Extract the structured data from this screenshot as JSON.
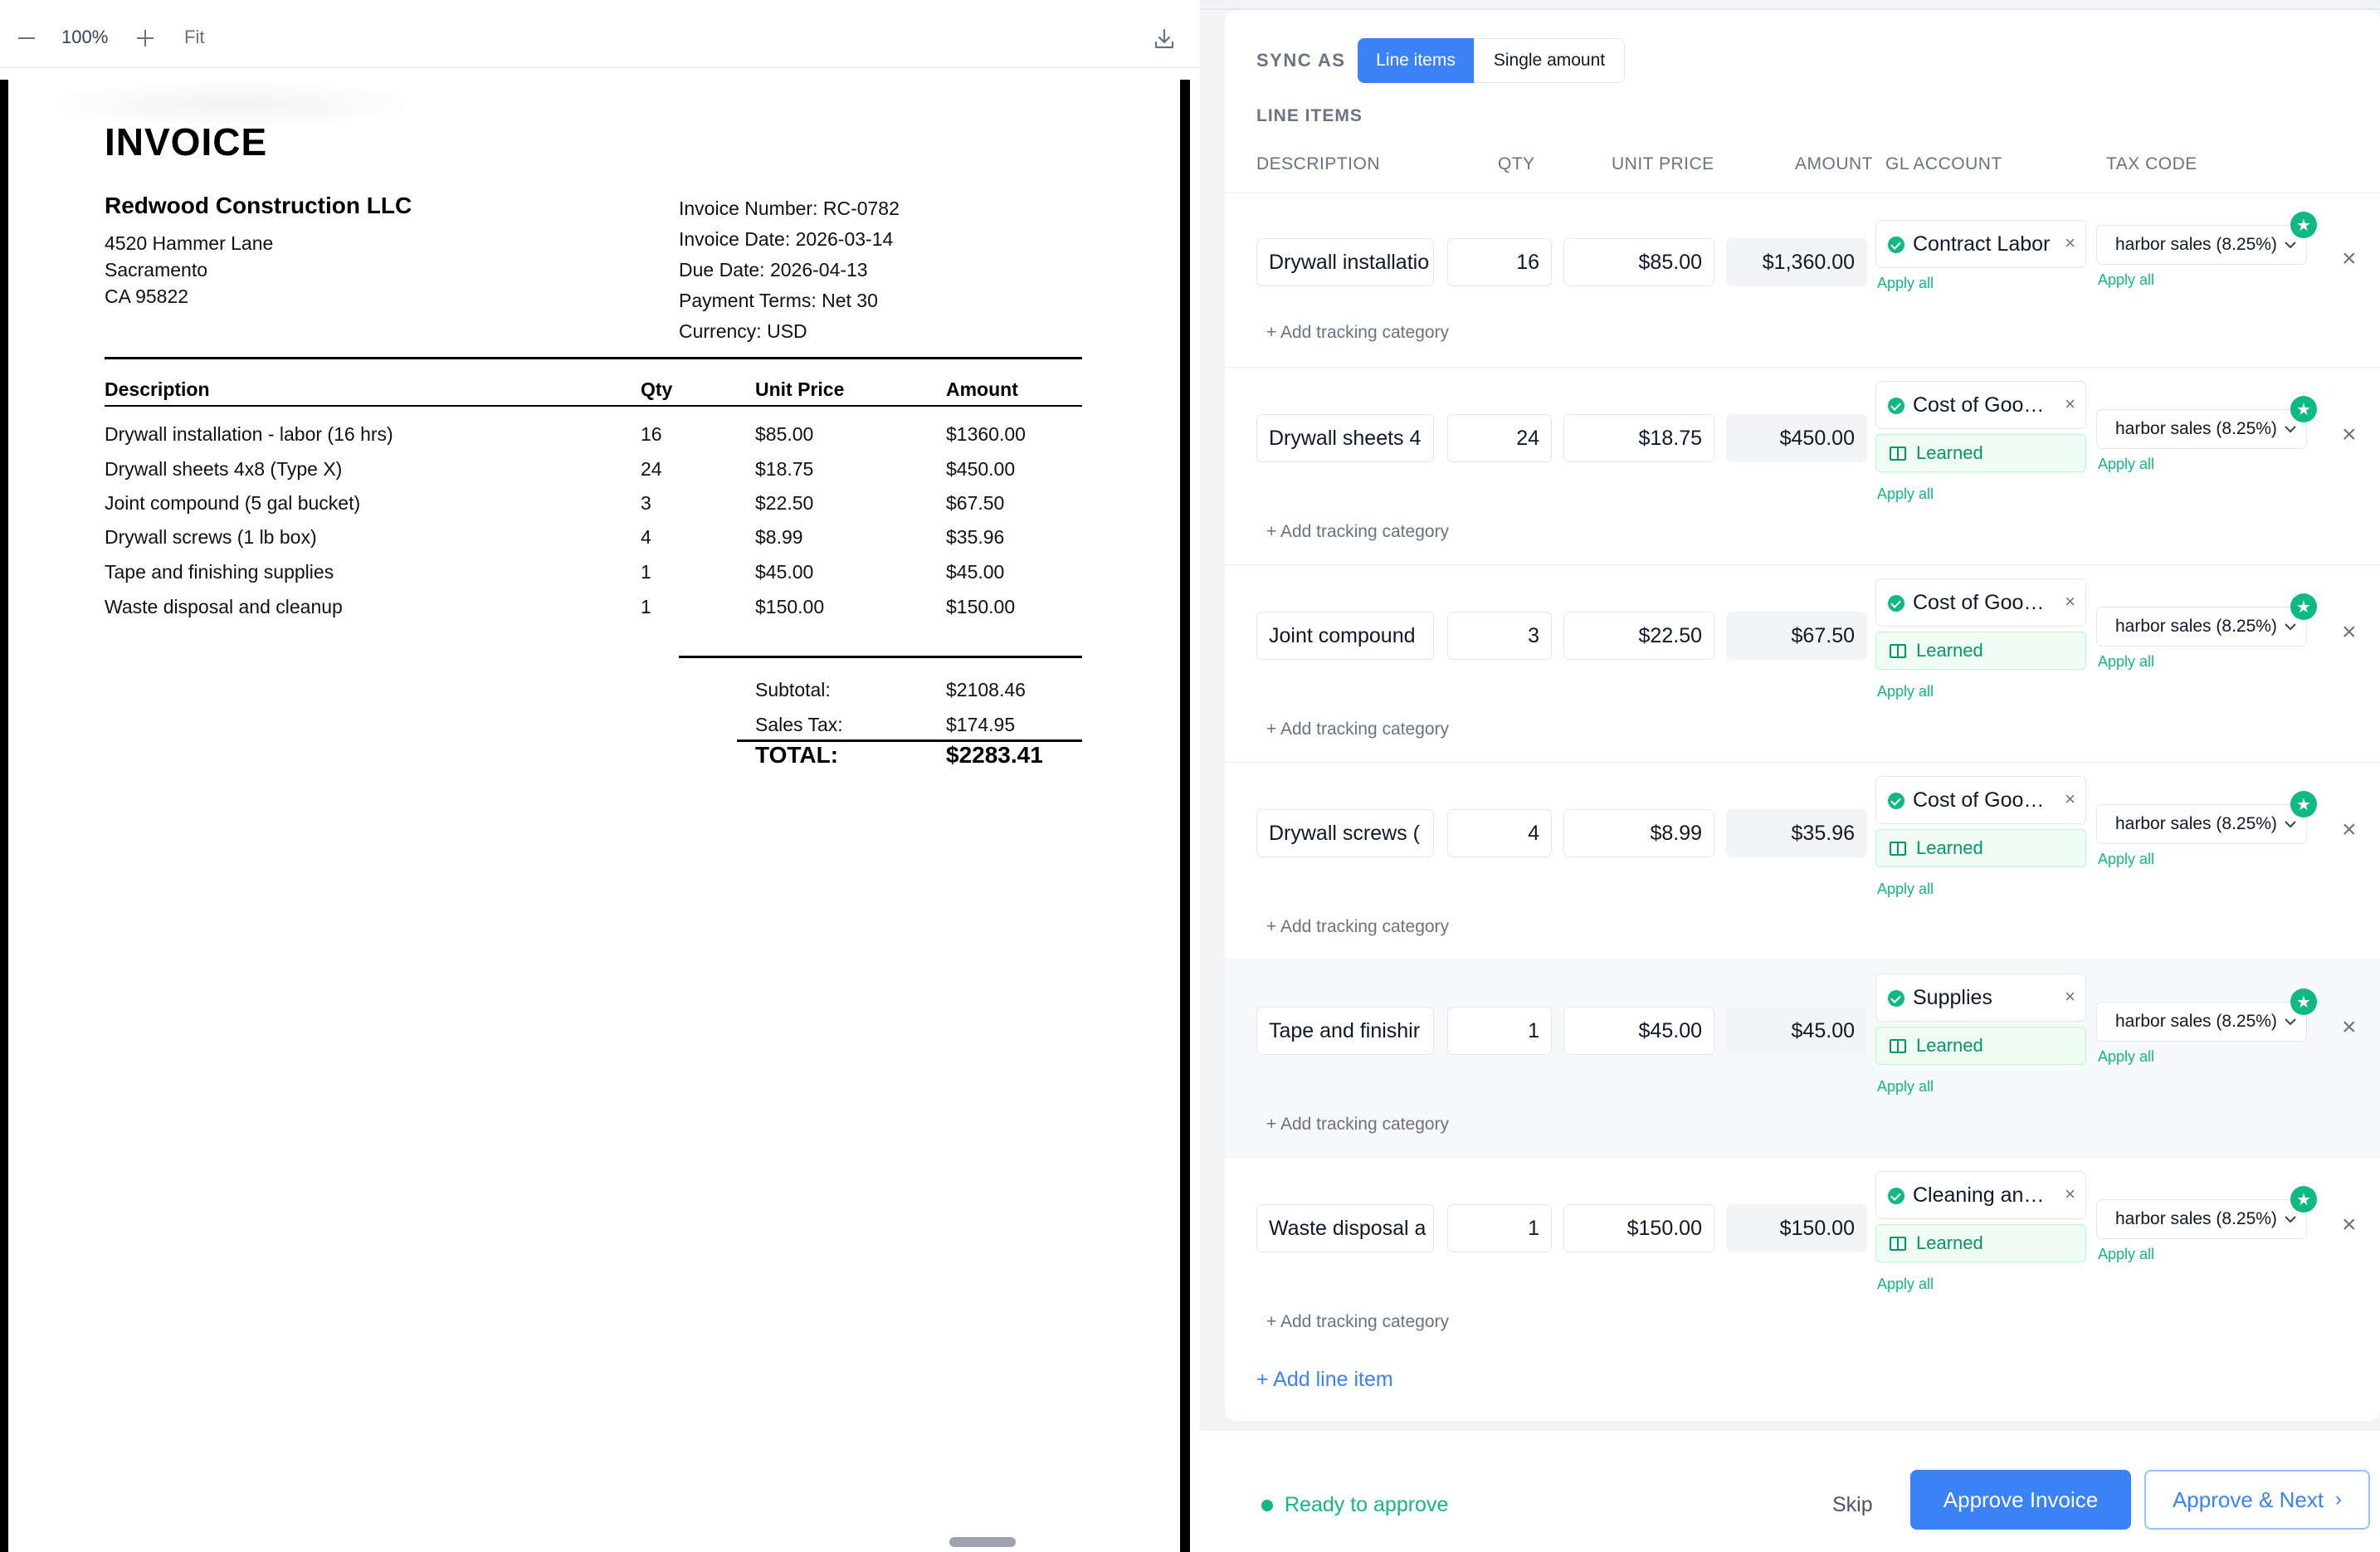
{
  "viewer": {
    "zoom": "100%",
    "fit_label": "Fit",
    "icons": {
      "zoom_out": "minus-icon",
      "zoom_in": "plus-icon",
      "download": "download-icon"
    }
  },
  "invoice": {
    "title": "INVOICE",
    "vendor": {
      "name": "Redwood Construction LLC",
      "address": [
        "4520 Hammer Lane",
        "Sacramento",
        "CA 95822"
      ]
    },
    "meta": [
      "Invoice Number: RC-0782",
      "Invoice Date: 2026-03-14",
      "Due Date: 2026-04-13",
      "Payment Terms: Net 30",
      "Currency: USD"
    ],
    "columns": {
      "description": "Description",
      "qty": "Qty",
      "unit_price": "Unit Price",
      "amount": "Amount"
    },
    "lines": [
      {
        "description": "Drywall installation - labor (16 hrs)",
        "qty": "16",
        "unit_price": "$85.00",
        "amount": "$1360.00"
      },
      {
        "description": "Drywall sheets 4x8 (Type X)",
        "qty": "24",
        "unit_price": "$18.75",
        "amount": "$450.00"
      },
      {
        "description": "Joint compound (5 gal bucket)",
        "qty": "3",
        "unit_price": "$22.50",
        "amount": "$67.50"
      },
      {
        "description": "Drywall screws (1 lb box)",
        "qty": "4",
        "unit_price": "$8.99",
        "amount": "$35.96"
      },
      {
        "description": "Tape and finishing supplies",
        "qty": "1",
        "unit_price": "$45.00",
        "amount": "$45.00"
      },
      {
        "description": "Waste disposal and cleanup",
        "qty": "1",
        "unit_price": "$150.00",
        "amount": "$150.00"
      }
    ],
    "totals": {
      "subtotal_label": "Subtotal:",
      "subtotal": "$2108.46",
      "tax_label": "Sales Tax:",
      "tax": "$174.95",
      "total_label": "TOTAL:",
      "total": "$2283.41"
    }
  },
  "sync": {
    "label": "SYNC AS",
    "options": [
      "Line items",
      "Single amount"
    ],
    "selected": "Line items"
  },
  "line_items": {
    "title": "LINE ITEMS",
    "headers": {
      "description": "DESCRIPTION",
      "qty": "QTY",
      "unit_price": "UNIT PRICE",
      "amount": "AMOUNT",
      "gl_account": "GL ACCOUNT",
      "tax_code": "TAX CODE"
    },
    "rows": [
      {
        "description": "Drywall installatio",
        "qty": "16",
        "unit_price": "$85.00",
        "amount": "$1,360.00",
        "gl_account": "Contract Labor",
        "learned": "",
        "tax_code": "harbor sales (8.25%)"
      },
      {
        "description": "Drywall sheets 4",
        "qty": "24",
        "unit_price": "$18.75",
        "amount": "$450.00",
        "gl_account": "Cost of Goo…",
        "learned": "Learned",
        "tax_code": "harbor sales (8.25%)"
      },
      {
        "description": "Joint compound",
        "qty": "3",
        "unit_price": "$22.50",
        "amount": "$67.50",
        "gl_account": "Cost of Goo…",
        "learned": "Learned",
        "tax_code": "harbor sales (8.25%)"
      },
      {
        "description": "Drywall screws (",
        "qty": "4",
        "unit_price": "$8.99",
        "amount": "$35.96",
        "gl_account": "Cost of Goo…",
        "learned": "Learned",
        "tax_code": "harbor sales (8.25%)"
      },
      {
        "description": "Tape and finishir",
        "qty": "1",
        "unit_price": "$45.00",
        "amount": "$45.00",
        "gl_account": "Supplies",
        "learned": "Learned",
        "tax_code": "harbor sales (8.25%)"
      },
      {
        "description": "Waste disposal a",
        "qty": "1",
        "unit_price": "$150.00",
        "amount": "$150.00",
        "gl_account": "Cleaning an…",
        "learned": "Learned",
        "tax_code": "harbor sales (8.25%)"
      }
    ],
    "apply_all": "Apply all",
    "add_tracking": "+ Add tracking category",
    "add_line": "+ Add line item"
  },
  "footer": {
    "status": "Ready to approve",
    "skip": "Skip",
    "approve": "Approve Invoice",
    "approve_next": "Approve & Next"
  },
  "colors": {
    "accent": "#3b82f6",
    "success": "#10b981",
    "learned_bg": "#f0fdf4"
  }
}
